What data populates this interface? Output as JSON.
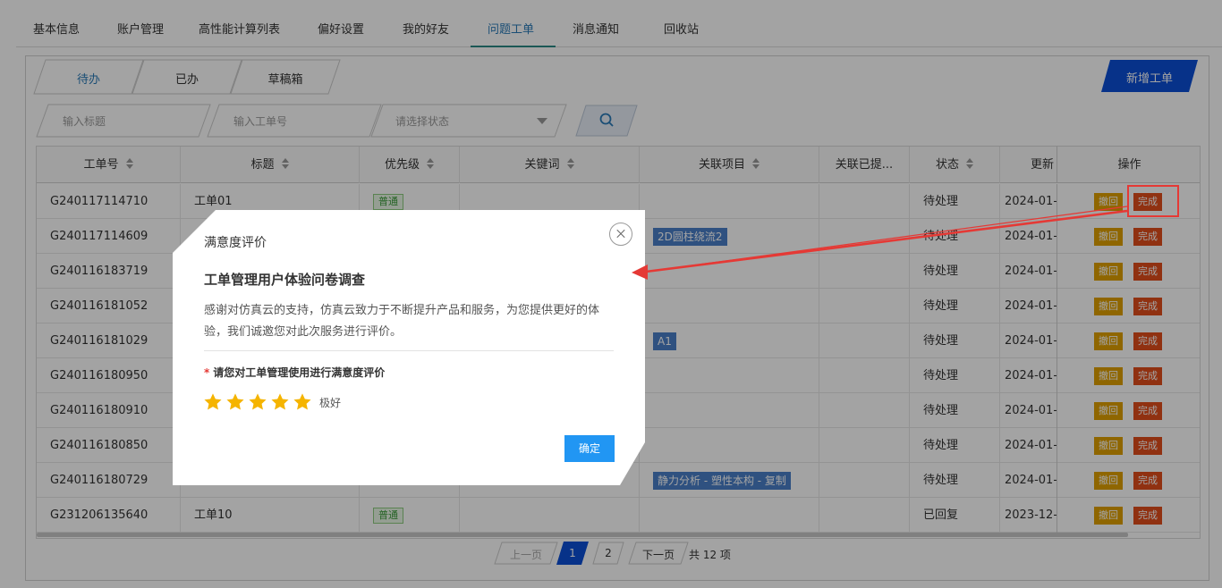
{
  "top_tabs": [
    {
      "label": "基本信息",
      "active": false
    },
    {
      "label": "账户管理",
      "active": false
    },
    {
      "label": "高性能计算列表",
      "active": false
    },
    {
      "label": "偏好设置",
      "active": false
    },
    {
      "label": "我的好友",
      "active": false
    },
    {
      "label": "问题工单",
      "active": true
    },
    {
      "label": "消息通知",
      "active": false
    },
    {
      "label": "回收站",
      "active": false
    }
  ],
  "sub_tabs": [
    {
      "label": "待办",
      "active": true
    },
    {
      "label": "已办",
      "active": false
    },
    {
      "label": "草稿箱",
      "active": false
    }
  ],
  "new_button": "新增工单",
  "filters": {
    "title_placeholder": "输入标题",
    "ticket_placeholder": "输入工单号",
    "status_placeholder": "请选择状态"
  },
  "table": {
    "headers": [
      "工单号",
      "标题",
      "优先级",
      "关键词",
      "关联项目",
      "关联已提...",
      "状态",
      "更新",
      "操作"
    ],
    "rows": [
      {
        "id": "G240117114710",
        "title": "工单01",
        "priority": "普通",
        "project": "",
        "status": "待处理",
        "updated": "2024-01-"
      },
      {
        "id": "G240117114609",
        "title": "",
        "priority": "",
        "project": "2D圆柱绕流2",
        "status": "待处理",
        "updated": "2024-01-"
      },
      {
        "id": "G240116183719",
        "title": "",
        "priority": "",
        "project": "",
        "status": "待处理",
        "updated": "2024-01-"
      },
      {
        "id": "G240116181052",
        "title": "",
        "priority": "",
        "project": "",
        "status": "待处理",
        "updated": "2024-01-"
      },
      {
        "id": "G240116181029",
        "title": "",
        "priority": "",
        "project": "A1",
        "status": "待处理",
        "updated": "2024-01-"
      },
      {
        "id": "G240116180950",
        "title": "",
        "priority": "",
        "project": "",
        "status": "待处理",
        "updated": "2024-01-"
      },
      {
        "id": "G240116180910",
        "title": "",
        "priority": "",
        "project": "",
        "status": "待处理",
        "updated": "2024-01-"
      },
      {
        "id": "G240116180850",
        "title": "",
        "priority": "",
        "project": "",
        "status": "待处理",
        "updated": "2024-01-"
      },
      {
        "id": "G240116180729",
        "title": "",
        "priority": "",
        "project": "静力分析 - 塑性本构 - 复制",
        "status": "待处理",
        "updated": "2024-01-"
      },
      {
        "id": "G231206135640",
        "title": "工单10",
        "priority": "普通",
        "project": "",
        "status": "已回复",
        "updated": "2023-12-"
      }
    ],
    "undo_label": "撤回",
    "done_label": "完成"
  },
  "pagination": {
    "prev": "上一页",
    "pages": [
      "1",
      "2"
    ],
    "current": "1",
    "next": "下一页",
    "total": "共 12 项"
  },
  "modal": {
    "title": "满意度评价",
    "heading": "工单管理用户体验问卷调查",
    "description": "感谢对仿真云的支持，仿真云致力于不断提升产品和服务，为您提供更好的体验，我们诚邀您对此次服务进行评价。",
    "required_mark": "*",
    "question": "请您对工单管理使用进行满意度评价",
    "rating": 5,
    "rating_max": 5,
    "rating_text": "极好",
    "confirm": "确定"
  },
  "colors": {
    "accent": "#2a7ab8",
    "primary_button": "#0b4fd6",
    "confirm_button": "#2196f3",
    "undo_button": "#e0a000",
    "done_button": "#e24d1c",
    "star": "#f5b400",
    "annotation": "#e53935"
  }
}
